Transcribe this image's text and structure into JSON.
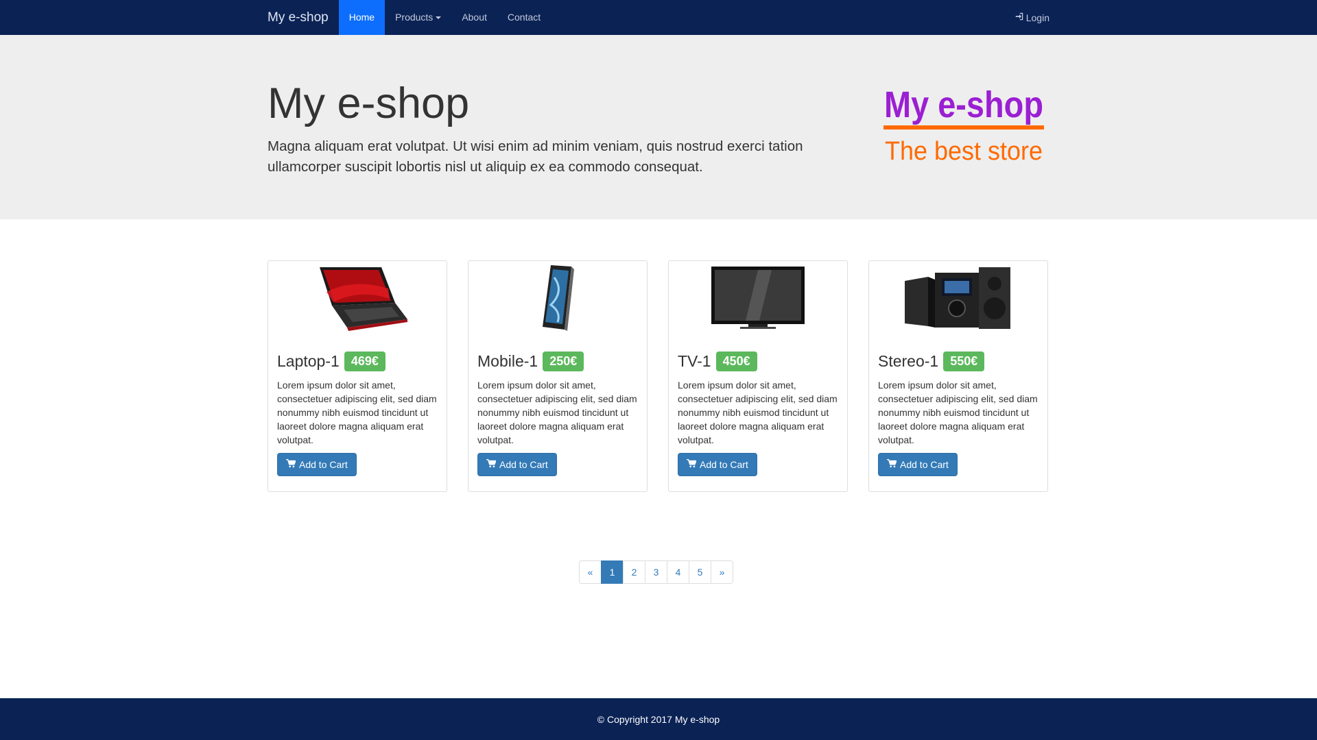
{
  "navbar": {
    "brand": "My e-shop",
    "items": [
      {
        "label": "Home",
        "active": true
      },
      {
        "label": "Products",
        "dropdown": true
      },
      {
        "label": "About"
      },
      {
        "label": "Contact"
      }
    ],
    "login_label": "Login",
    "login_icon": "log-in-icon"
  },
  "hero": {
    "title": "My e-shop",
    "text": "Magna aliquam erat volutpat. Ut wisi enim ad minim veniam, quis nostrud exerci tation ullamcorper suscipit lobortis nisl ut aliquip ex ea commodo consequat.",
    "logo": {
      "line1": "My e-shop",
      "line2": "The best store",
      "color1": "#9b1fd3",
      "color2": "#ff6a00"
    }
  },
  "products": [
    {
      "name": "Laptop-1",
      "price": "469€",
      "image_icon": "laptop-icon",
      "desc": "Lorem ipsum dolor sit amet, consectetuer adipiscing elit, sed diam nonummy nibh euismod tincidunt ut laoreet dolore magna aliquam erat volutpat.",
      "button": "Add to Cart"
    },
    {
      "name": "Mobile-1",
      "price": "250€",
      "image_icon": "smartphone-icon",
      "desc": "Lorem ipsum dolor sit amet, consectetuer adipiscing elit, sed diam nonummy nibh euismod tincidunt ut laoreet dolore magna aliquam erat volutpat.",
      "button": "Add to Cart"
    },
    {
      "name": "TV-1",
      "price": "450€",
      "image_icon": "tv-icon",
      "desc": "Lorem ipsum dolor sit amet, consectetuer adipiscing elit, sed diam nonummy nibh euismod tincidunt ut laoreet dolore magna aliquam erat volutpat.",
      "button": "Add to Cart"
    },
    {
      "name": "Stereo-1",
      "price": "550€",
      "image_icon": "stereo-icon",
      "desc": "Lorem ipsum dolor sit amet, consectetuer adipiscing elit, sed diam nonummy nibh euismod tincidunt ut laoreet dolore magna aliquam erat volutpat.",
      "button": "Add to Cart"
    }
  ],
  "pagination": {
    "prev": "«",
    "pages": [
      "1",
      "2",
      "3",
      "4",
      "5"
    ],
    "active": "1",
    "next": "»"
  },
  "footer": {
    "text": "© Copyright 2017 My e-shop"
  },
  "colors": {
    "navbar_bg": "#0b2255",
    "active_tab": "#0d6efd",
    "price_badge": "#5cb85c",
    "primary_button": "#337ab7"
  }
}
